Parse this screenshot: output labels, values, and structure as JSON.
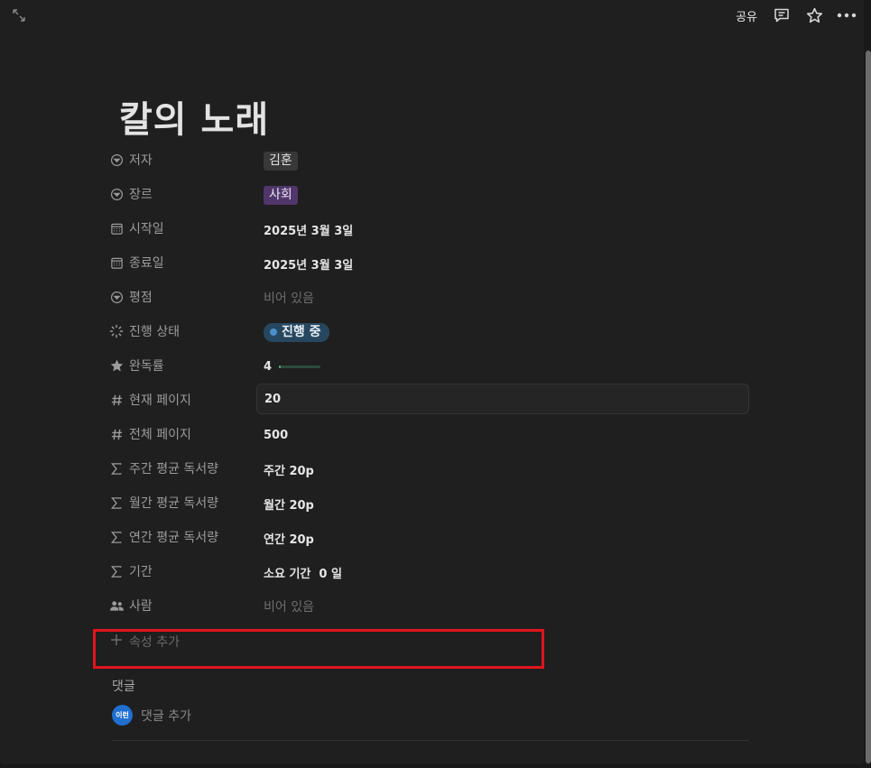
{
  "topbar": {
    "share_label": "공유",
    "icons": [
      "expand-icon",
      "comment-icon",
      "star-icon",
      "more-icon"
    ]
  },
  "page": {
    "title": "칼의 노래"
  },
  "properties": [
    {
      "key": "저자",
      "icon": "select-icon",
      "value": "김훈",
      "type": "tag"
    },
    {
      "key": "장르",
      "icon": "select-icon",
      "value": "사회",
      "type": "tag"
    },
    {
      "key": "시작일",
      "icon": "calendar-icon",
      "value": "2025년 3월 3일",
      "type": "date"
    },
    {
      "key": "종료일",
      "icon": "calendar-icon",
      "value": "2025년 3월 3일",
      "type": "date"
    },
    {
      "key": "평점",
      "icon": "select-icon",
      "value": "비어 있음",
      "type": "empty"
    },
    {
      "key": "진행 상태",
      "icon": "status-icon",
      "value": "진행 중",
      "type": "status"
    },
    {
      "key": "완독률",
      "icon": "star-filled-icon",
      "value": "4",
      "progress": 0.04,
      "type": "progress"
    },
    {
      "key": "현재 페이지",
      "icon": "hash-icon",
      "value": "20",
      "type": "number-editing"
    },
    {
      "key": "전체 페이지",
      "icon": "hash-icon",
      "value": "500",
      "type": "number"
    },
    {
      "key": "주간 평균 독서량",
      "icon": "sigma-icon",
      "value": "주간 20p",
      "type": "formula"
    },
    {
      "key": "월간 평균 독서량",
      "icon": "sigma-icon",
      "value": "월간 20p",
      "type": "formula"
    },
    {
      "key": "연간 평균 독서량",
      "icon": "sigma-icon",
      "value": "연간 20p",
      "type": "formula"
    },
    {
      "key": "기간",
      "icon": "sigma-icon",
      "value": "소요 기간  0 일",
      "type": "formula"
    },
    {
      "key": "사람",
      "icon": "people-icon",
      "value": "비어 있음",
      "type": "empty"
    }
  ],
  "add_property_label": "속성 추가",
  "comments": {
    "label": "댓글",
    "avatar_text": "이런",
    "add_label": "댓글 추가"
  },
  "colors": {
    "background": "#1f1f1f",
    "tag_purple": "#50366b",
    "status_blue": "#274760",
    "progress_green": "#4caf7d",
    "highlight_red": "#e0151c"
  }
}
